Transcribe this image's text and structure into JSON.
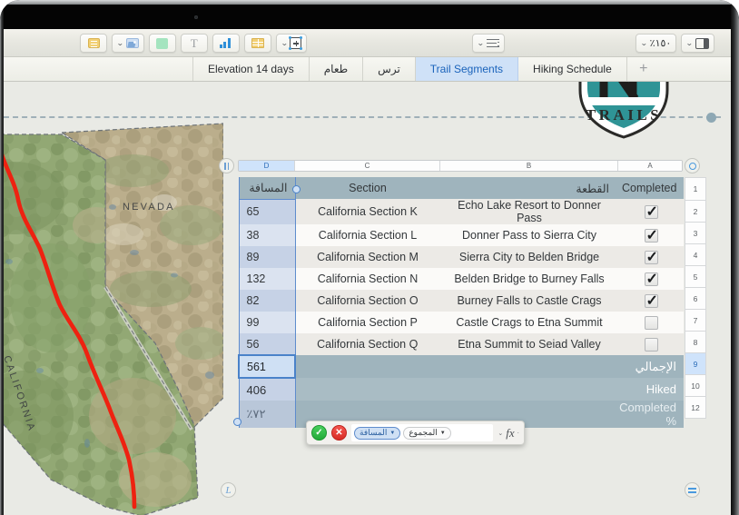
{
  "toolbar": {
    "left_buttons": [
      {
        "name": "document-icon",
        "label": ""
      },
      {
        "name": "media-icon",
        "label": ""
      },
      {
        "name": "shape-icon",
        "label": ""
      },
      {
        "name": "text-icon",
        "label": "T"
      },
      {
        "name": "chart-icon",
        "label": ""
      },
      {
        "name": "table-icon",
        "label": ""
      },
      {
        "name": "insert-icon",
        "label": ""
      }
    ],
    "list_button_label": "",
    "zoom_label": "٪١٥٠",
    "view_button_label": ""
  },
  "tabs": [
    {
      "label": "Elevation 14 days",
      "active": false,
      "rtl": false
    },
    {
      "label": "طعام",
      "active": false,
      "rtl": true
    },
    {
      "label": "ترس",
      "active": false,
      "rtl": true
    },
    {
      "label": "Trail Segments",
      "active": true,
      "rtl": false
    },
    {
      "label": "Hiking Schedule",
      "active": false,
      "rtl": false
    }
  ],
  "tab_add_label": "+",
  "badge": {
    "bottom_text": "TRAILS",
    "mark": "N",
    "color": "#2f9496"
  },
  "map": {
    "labels": [
      "NEVADA",
      "CALIFORNIA"
    ],
    "trail_color": "#ee2211"
  },
  "table": {
    "column_headers": [
      {
        "label": "D",
        "selected": true
      },
      {
        "label": "C",
        "selected": false
      },
      {
        "label": "B",
        "selected": false
      },
      {
        "label": "A",
        "selected": false
      }
    ],
    "header_row": {
      "distance": "المسافة",
      "section": "Section",
      "leg": "القطعة",
      "completed": "Completed"
    },
    "rows": [
      {
        "distance": "65",
        "section": "California Section K",
        "leg": "Echo Lake Resort to Donner Pass",
        "completed": true
      },
      {
        "distance": "38",
        "section": "California Section L",
        "leg": "Donner Pass to Sierra City",
        "completed": true
      },
      {
        "distance": "89",
        "section": "California Section M",
        "leg": "Sierra City to Belden Bridge",
        "completed": true
      },
      {
        "distance": "132",
        "section": "California Section N",
        "leg": "Belden Bridge to Burney Falls",
        "completed": true
      },
      {
        "distance": "82",
        "section": "California Section O",
        "leg": "Burney Falls to Castle Crags",
        "completed": true
      },
      {
        "distance": "99",
        "section": "California Section P",
        "leg": "Castle Crags to Etna Summit",
        "completed": false
      },
      {
        "distance": "56",
        "section": "California Section Q",
        "leg": "Etna Summit to Seiad Valley",
        "completed": false
      }
    ],
    "summary": [
      {
        "value": "561",
        "label": "الإجمالي"
      },
      {
        "value": "406",
        "label": "Hiked"
      },
      {
        "value": "٪٧٢",
        "label": "Completed %"
      }
    ],
    "row_numbers": [
      "1",
      "2",
      "3",
      "4",
      "5",
      "6",
      "7",
      "8",
      "9",
      "10",
      "12"
    ],
    "selected_row_number": "9"
  },
  "formula_bar": {
    "accept_label": "✓",
    "cancel_label": "✕",
    "token_function": "المجموع",
    "token_range": "المسافة",
    "fx_label": "fx"
  }
}
